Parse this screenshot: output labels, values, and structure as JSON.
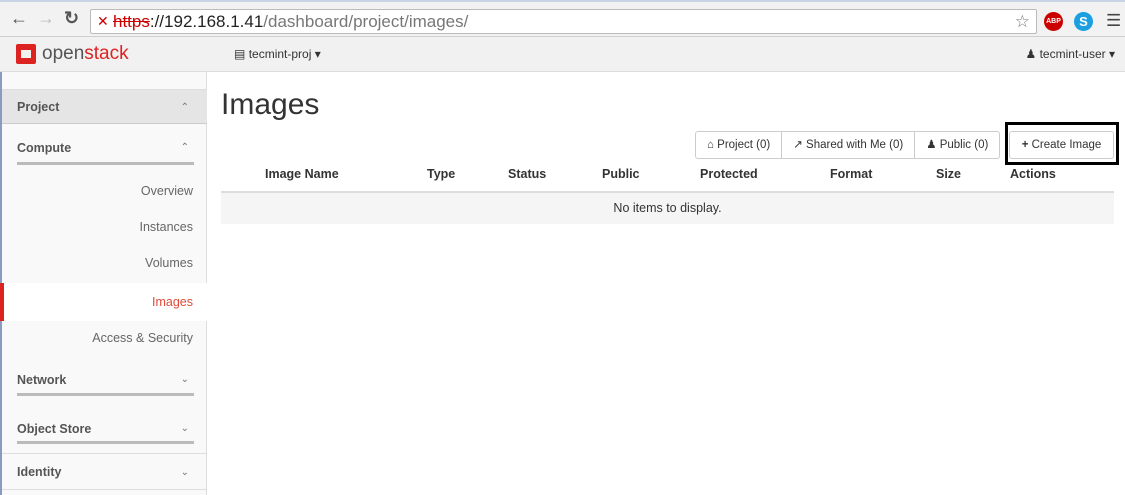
{
  "browser": {
    "url_scheme": "https",
    "url_host": "://192.168.1.41",
    "url_path": "/dashboard/project/images/",
    "extensions": [
      "ABP",
      "S"
    ]
  },
  "header": {
    "brand_prefix": "open",
    "brand_suffix": "stack",
    "project": "tecmint-proj",
    "user": "tecmint-user"
  },
  "sidebar": {
    "project": "Project",
    "compute": "Compute",
    "items": [
      "Overview",
      "Instances",
      "Volumes",
      "Images",
      "Access & Security"
    ],
    "network": "Network",
    "object_store": "Object Store",
    "identity": "Identity"
  },
  "main": {
    "title": "Images",
    "filters": [
      "Project (0)",
      "Shared with Me (0)",
      "Public (0)"
    ],
    "create_label": "Create Image",
    "columns": [
      "Image Name",
      "Type",
      "Status",
      "Public",
      "Protected",
      "Format",
      "Size",
      "Actions"
    ],
    "empty": "No items to display."
  },
  "colors": {
    "accent": "#dd2222",
    "active_text": "#e04a3a"
  }
}
